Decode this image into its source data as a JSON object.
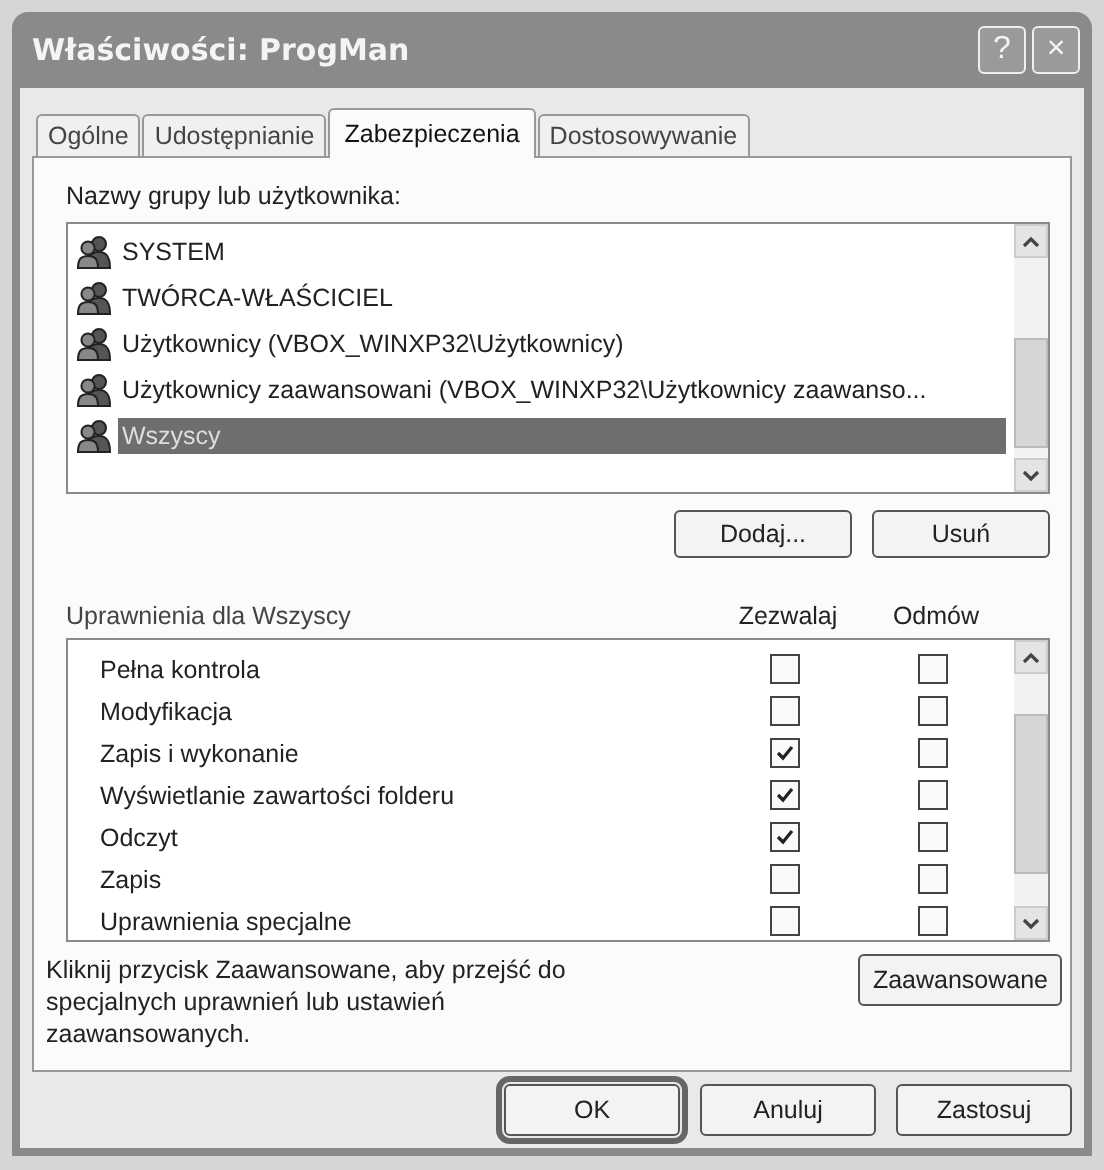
{
  "window": {
    "title": "Właściwości: ProgMan",
    "buttons": [
      "?",
      "×"
    ]
  },
  "tabs": [
    {
      "label": "Ogólne",
      "selected": false
    },
    {
      "label": "Udostępnianie",
      "selected": false
    },
    {
      "label": "Zabezpieczenia",
      "selected": true
    },
    {
      "label": "Dostosowywanie",
      "selected": false
    }
  ],
  "users": {
    "label": "Nazwy grupy lub użytkownika:",
    "items": [
      {
        "name": "SYSTEM",
        "selected": false
      },
      {
        "name": "TWÓRCA-WŁAŚCICIEL",
        "selected": false
      },
      {
        "name": "Użytkownicy (VBOX_WINXP32\\Użytkownicy)",
        "selected": false
      },
      {
        "name": "Użytkownicy zaawansowani (VBOX_WINXP32\\Użytkownicy zaawanso...",
        "selected": false
      },
      {
        "name": "Wszyscy",
        "selected": true
      }
    ],
    "buttons": [
      "Dodaj...",
      "Usuń"
    ]
  },
  "permissions": {
    "label": "Uprawnienia dla Wszyscy",
    "columns": [
      "Zezwalaj",
      "Odmów"
    ],
    "rows": [
      {
        "name": "Pełna kontrola",
        "allow": false,
        "deny": false
      },
      {
        "name": "Modyfikacja",
        "allow": false,
        "deny": false
      },
      {
        "name": "Zapis i wykonanie",
        "allow": true,
        "deny": false
      },
      {
        "name": "Wyświetlanie zawartości folderu",
        "allow": true,
        "deny": false
      },
      {
        "name": "Odczyt",
        "allow": true,
        "deny": false
      },
      {
        "name": "Zapis",
        "allow": false,
        "deny": false
      },
      {
        "name": "Uprawnienia specjalne",
        "allow": false,
        "deny": false
      }
    ]
  },
  "advanced": {
    "text": "Kliknij przycisk Zaawansowane, aby przejść do specjalnych uprawnień lub ustawień zaawansowanych.",
    "button": "Zaawansowane"
  },
  "footer": [
    {
      "label": "OK",
      "default": true
    },
    {
      "label": "Anuluj",
      "default": false
    },
    {
      "label": "Zastosuj",
      "default": false
    }
  ]
}
